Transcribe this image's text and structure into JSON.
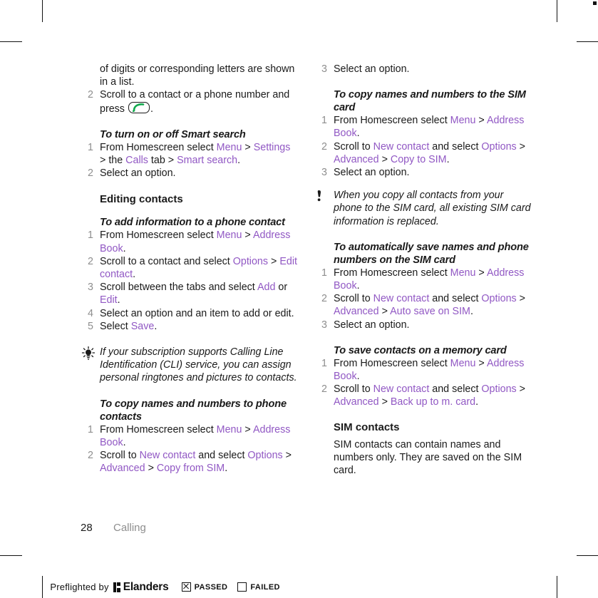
{
  "document": {
    "page_number": "28",
    "chapter": "Calling"
  },
  "colors": {
    "ui_term": "#9158c4",
    "list_number": "#8e8e8e",
    "body_text": "#1a1a1a",
    "call_key_green": "#13a94e"
  },
  "left_column": {
    "continued_step_text": "of digits or corresponding letters are shown in a list.",
    "step2": {
      "num": "2",
      "text_before": "Scroll to a contact or a phone number and press ",
      "icon": "green-call-key-icon",
      "text_after": "."
    },
    "smart_search": {
      "heading": "To turn on or off Smart search",
      "steps": [
        {
          "num": "1",
          "parts": [
            "From Homescreen select ",
            "Menu",
            " > ",
            "Settings",
            " > the ",
            "Calls",
            " tab > ",
            "Smart search",
            "."
          ]
        },
        {
          "num": "2",
          "parts": [
            "Select an option."
          ]
        }
      ]
    },
    "editing_contacts": {
      "heading": "Editing contacts",
      "add_info": {
        "heading": "To add information to a phone contact",
        "steps": [
          {
            "num": "1",
            "parts": [
              "From Homescreen select ",
              "Menu",
              " > ",
              "Address Book",
              "."
            ]
          },
          {
            "num": "2",
            "parts": [
              "Scroll to a contact and select ",
              "Options",
              " > ",
              "Edit contact",
              "."
            ]
          },
          {
            "num": "3",
            "parts": [
              "Scroll between the tabs and select ",
              "Add",
              " or ",
              "Edit",
              "."
            ]
          },
          {
            "num": "4",
            "parts": [
              "Select an option and an item to add or edit."
            ]
          },
          {
            "num": "5",
            "parts": [
              "Select ",
              "Save",
              "."
            ]
          }
        ]
      }
    },
    "tip": {
      "icon": "lightbulb-tip-icon",
      "text": "If your subscription supports Calling Line Identification (CLI) service, you can assign personal ringtones and pictures to contacts."
    },
    "copy_to_phone": {
      "heading": "To copy names and numbers to phone contacts",
      "steps": [
        {
          "num": "1",
          "parts": [
            "From Homescreen select ",
            "Menu",
            " > ",
            "Address Book",
            "."
          ]
        },
        {
          "num": "2",
          "parts": [
            "Scroll to ",
            "New contact",
            " and select ",
            "Options",
            " > ",
            "Advanced",
            " > ",
            "Copy from SIM",
            "."
          ]
        }
      ]
    }
  },
  "right_column": {
    "step3_top": {
      "num": "3",
      "parts": [
        "Select an option."
      ]
    },
    "copy_to_sim": {
      "heading": "To copy names and numbers to the SIM card",
      "steps": [
        {
          "num": "1",
          "parts": [
            "From Homescreen select ",
            "Menu",
            " > ",
            "Address Book",
            "."
          ]
        },
        {
          "num": "2",
          "parts": [
            "Scroll to ",
            "New contact",
            " and select ",
            "Options",
            " > ",
            "Advanced",
            " > ",
            "Copy to SIM",
            "."
          ]
        },
        {
          "num": "3",
          "parts": [
            "Select an option."
          ]
        }
      ]
    },
    "note": {
      "icon": "exclamation-note-icon",
      "text": "When you copy all contacts from your phone to the SIM card, all existing SIM card information is replaced."
    },
    "auto_save": {
      "heading": "To automatically save names and phone numbers on the SIM card",
      "steps": [
        {
          "num": "1",
          "parts": [
            "From Homescreen select ",
            "Menu",
            " > ",
            "Address Book",
            "."
          ]
        },
        {
          "num": "2",
          "parts": [
            "Scroll to ",
            "New contact",
            " and select ",
            "Options",
            " > ",
            "Advanced",
            " > ",
            "Auto save on SIM",
            "."
          ]
        },
        {
          "num": "3",
          "parts": [
            "Select an option."
          ]
        }
      ]
    },
    "memory_card": {
      "heading": "To save contacts on a memory card",
      "steps": [
        {
          "num": "1",
          "parts": [
            "From Homescreen select ",
            "Menu",
            " > ",
            "Address Book",
            "."
          ]
        },
        {
          "num": "2",
          "parts": [
            "Scroll to ",
            "New contact",
            " and select ",
            "Options",
            " > ",
            "Advanced",
            " > ",
            "Back up to m. card",
            "."
          ]
        }
      ]
    },
    "sim_contacts": {
      "heading": "SIM contacts",
      "text": "SIM contacts can contain names and numbers only. They are saved on the SIM card."
    }
  },
  "preflight_bar": {
    "prefix": "Preflighted by",
    "brand": "Elanders",
    "passed_label": "PASSED",
    "failed_label": "FAILED",
    "passed_checked": true,
    "failed_checked": false
  }
}
